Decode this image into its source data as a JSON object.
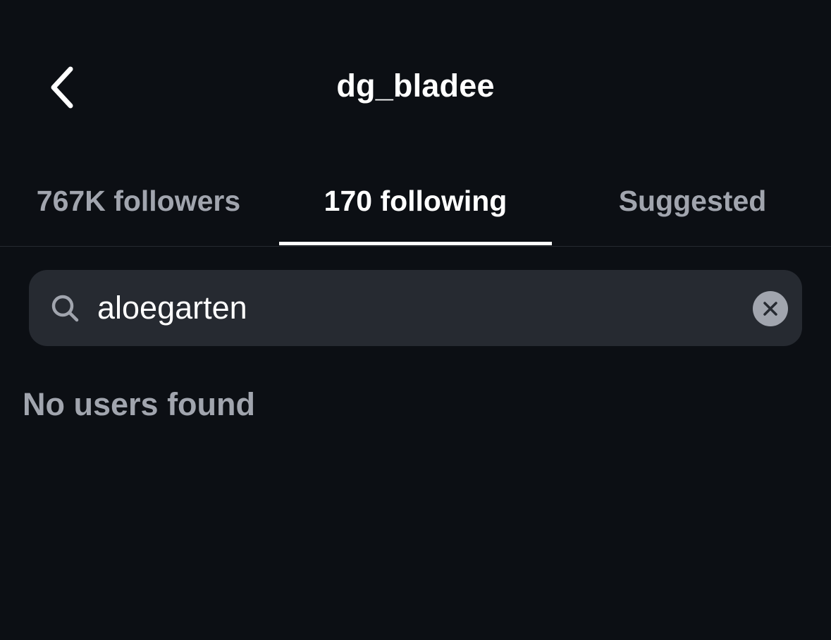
{
  "header": {
    "back_icon": "chevron-left-icon",
    "title": "dg_bladee"
  },
  "tabs": [
    {
      "label": "767K followers",
      "active": false
    },
    {
      "label": "170 following",
      "active": true
    },
    {
      "label": "Suggested",
      "active": false
    }
  ],
  "search": {
    "icon": "search-icon",
    "value": "aloegarten",
    "clear_icon": "close-icon"
  },
  "results": {
    "empty_message": "No users found"
  },
  "colors": {
    "background": "#0c0f14",
    "search_background": "#262a31",
    "primary_text": "#ffffff",
    "secondary_text": "#a1a5ae"
  }
}
